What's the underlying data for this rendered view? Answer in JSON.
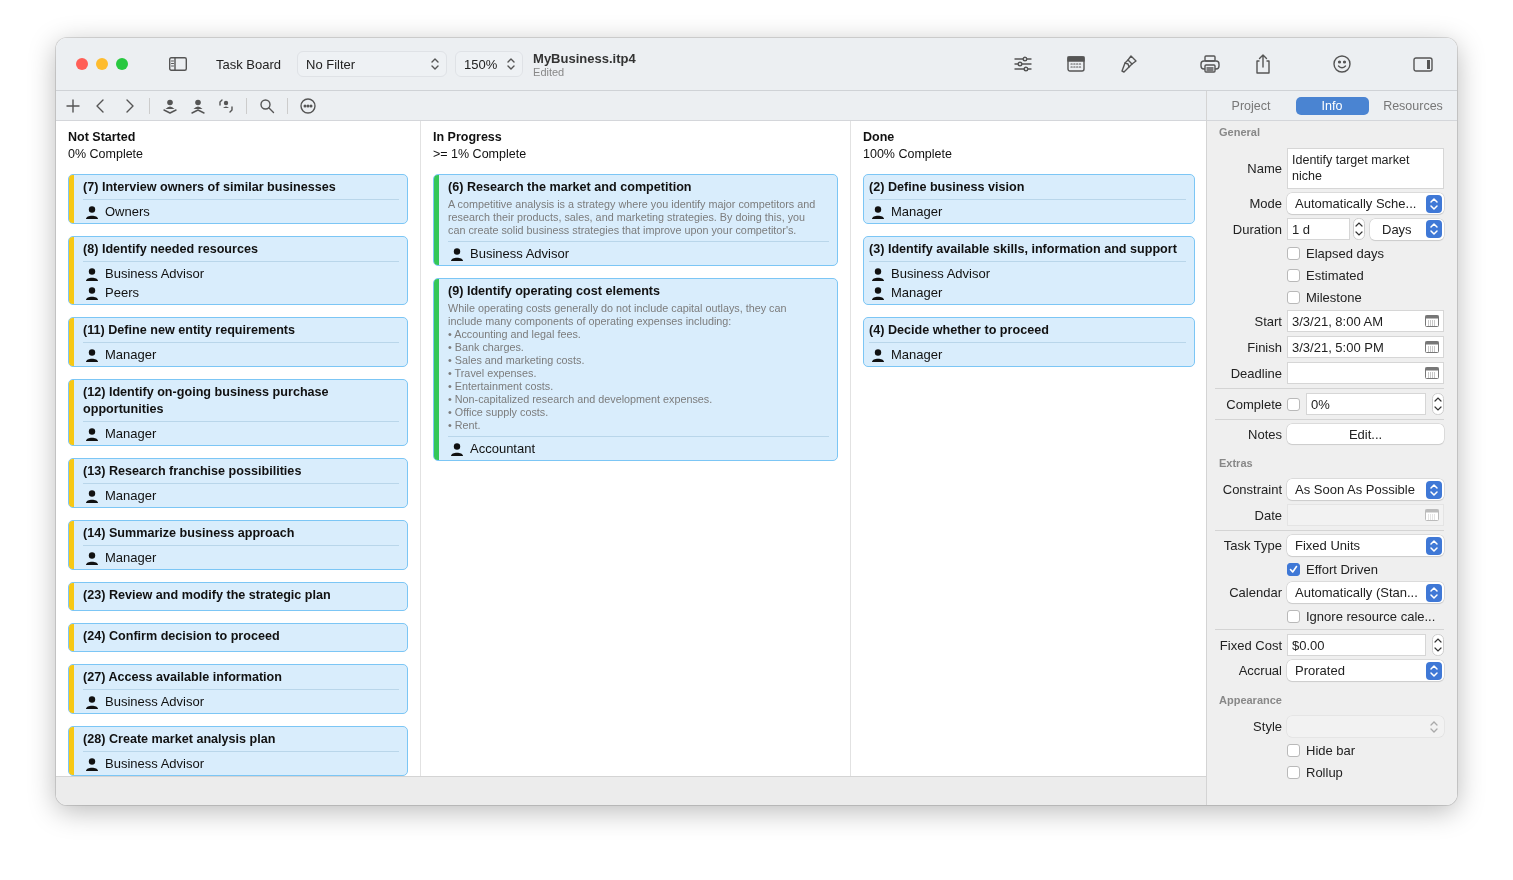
{
  "window": {
    "title": "MyBusiness.itp4",
    "subtitle": "Edited"
  },
  "toolbar": {
    "view_label": "Task Board",
    "filter": "No Filter",
    "zoom": "150%"
  },
  "board": {
    "columns": [
      {
        "title": "Not Started",
        "subtitle": "0% Complete",
        "cards": [
          {
            "title": "(7) Interview owners of similar businesses",
            "color": "#f7c815",
            "resources": [
              "Owners"
            ]
          },
          {
            "title": "(8) Identify needed resources",
            "color": "#f7c815",
            "resources": [
              "Business Advisor",
              "Peers"
            ]
          },
          {
            "title": "(11) Define new entity requirements",
            "color": "#f7c815",
            "resources": [
              "Manager"
            ]
          },
          {
            "title": "(12) Identify on-going business purchase opportunities",
            "color": "#f7c815",
            "resources": [
              "Manager"
            ]
          },
          {
            "title": "(13) Research franchise possibilities",
            "color": "#f7c815",
            "resources": [
              "Manager"
            ]
          },
          {
            "title": "(14) Summarize business approach",
            "color": "#f7c815",
            "resources": [
              "Manager"
            ]
          },
          {
            "title": "(23) Review and modify the strategic plan",
            "color": "#f7c815"
          },
          {
            "title": "(24) Confirm decision to proceed",
            "color": "#f7c815"
          },
          {
            "title": "(27) Access available information",
            "color": "#f7c815",
            "resources": [
              "Business Advisor"
            ]
          },
          {
            "title": "(28) Create market analysis plan",
            "color": "#f7c815",
            "resources": [
              "Business Advisor"
            ]
          }
        ]
      },
      {
        "title": "In Progress",
        "subtitle": ">= 1% Complete",
        "cards": [
          {
            "title": "(6) Research the market and competition",
            "color": "#34c759",
            "notes": [
              "A competitive analysis is a strategy where you identify major competitors and research their products, sales, and marketing strategies. By doing this, you can create solid business strategies that improve upon your competitor's."
            ],
            "resources": [
              "Business Advisor"
            ]
          },
          {
            "title": "(9) Identify operating cost elements",
            "color": "#34c759",
            "notes": [
              "While operating costs generally do not include capital outlays, they can include many components of operating expenses including:",
              "• Accounting and legal fees.",
              "• Bank charges.",
              "• Sales and marketing costs.",
              "• Travel expenses.",
              "• Entertainment costs.",
              "• Non-capitalized research and development expenses.",
              "• Office supply costs.",
              "• Rent."
            ],
            "resources": [
              "Accountant"
            ]
          }
        ]
      },
      {
        "title": "Done",
        "subtitle": "100% Complete",
        "cards": [
          {
            "title": "(2) Define business vision",
            "resources": [
              "Manager"
            ]
          },
          {
            "title": "(3) Identify available skills, information and support",
            "resources": [
              "Business Advisor",
              "Manager"
            ]
          },
          {
            "title": "(4) Decide whether to proceed",
            "resources": [
              "Manager"
            ]
          }
        ]
      }
    ]
  },
  "inspector": {
    "tabs": [
      {
        "label": "Project",
        "selected": false
      },
      {
        "label": "Info",
        "selected": true
      },
      {
        "label": "Resources",
        "selected": false
      }
    ],
    "sections": [
      {
        "title": "General",
        "rows": [
          {
            "kind": "text",
            "label": "Name",
            "value": "Identify target market niche"
          },
          {
            "kind": "popup",
            "label": "Mode",
            "value": "Automatically Sche...",
            "disabled": false
          },
          {
            "kind": "duration",
            "label": "Duration",
            "value": "1 d",
            "unit": "Days"
          },
          {
            "kind": "checkbox",
            "label": "Elapsed days",
            "checked": false
          },
          {
            "kind": "checkbox",
            "label": "Estimated",
            "checked": false
          },
          {
            "kind": "checkbox",
            "label": "Milestone",
            "checked": false
          },
          {
            "kind": "date",
            "label": "Start",
            "value": "3/3/21, 8:00 AM",
            "disabled": false
          },
          {
            "kind": "date",
            "label": "Finish",
            "value": "3/3/21, 5:00 PM",
            "disabled": false
          },
          {
            "kind": "date",
            "label": "Deadline",
            "disabled": false
          },
          {
            "kind": "divider"
          },
          {
            "kind": "complete",
            "label": "Complete",
            "checked": false,
            "value": "0%"
          },
          {
            "kind": "divider"
          },
          {
            "kind": "button",
            "label": "Notes",
            "value": "Edit..."
          }
        ]
      },
      {
        "title": "Extras",
        "rows": [
          {
            "kind": "popup",
            "label": "Constraint",
            "value": "As Soon As Possible",
            "disabled": false
          },
          {
            "kind": "date",
            "label": "Date",
            "disabled": true
          },
          {
            "kind": "divider"
          },
          {
            "kind": "popup",
            "label": "Task Type",
            "value": "Fixed Units",
            "disabled": false
          },
          {
            "kind": "checkbox",
            "label": "Effort Driven",
            "checked": true
          },
          {
            "kind": "popup",
            "label": "Calendar",
            "value": "Automatically (Stan...",
            "disabled": false
          },
          {
            "kind": "checkbox",
            "label": "Ignore resource cale...",
            "checked": false
          },
          {
            "kind": "divider"
          },
          {
            "kind": "number",
            "label": "Fixed Cost",
            "value": "$0.00"
          },
          {
            "kind": "popup",
            "label": "Accrual",
            "value": "Prorated",
            "disabled": false
          }
        ]
      },
      {
        "title": "Appearance",
        "rows": [
          {
            "kind": "popup",
            "label": "Style",
            "disabled": true
          },
          {
            "kind": "checkbox",
            "label": "Hide bar",
            "checked": false
          },
          {
            "kind": "checkbox",
            "label": "Rollup",
            "checked": false
          }
        ]
      }
    ]
  }
}
